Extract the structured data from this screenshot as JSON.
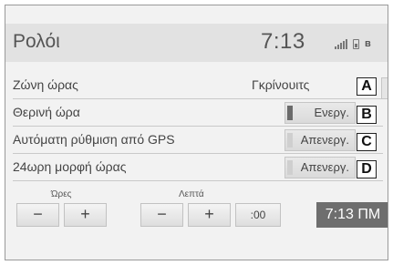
{
  "header": {
    "title": "Ρολόι",
    "clock": "7:13"
  },
  "rows": [
    {
      "label": "Ζώνη ώρας",
      "value": "Γκρίνουιτς",
      "callout": "A"
    },
    {
      "label": "Θερινή ώρα",
      "value": "Ενεργ.",
      "state": "on",
      "callout": "B"
    },
    {
      "label": "Αυτόματη ρύθμιση από GPS",
      "value": "Απενεργ.",
      "state": "off",
      "callout": "C"
    },
    {
      "label": "24ωρη μορφή ώρας",
      "value": "Απενεργ.",
      "state": "off",
      "callout": "D"
    }
  ],
  "adjust": {
    "hours_label": "Ώρες",
    "minutes_label": "Λεπτά",
    "minus": "−",
    "plus": "+",
    "reset": ":00",
    "current_time": "7:13 ΠΜ"
  }
}
